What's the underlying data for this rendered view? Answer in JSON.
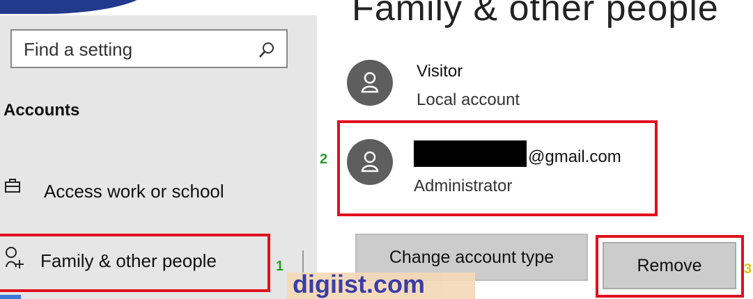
{
  "colors": {
    "highlight": "#e0101e",
    "step_number": "#2a9d2a",
    "avatar_bg": "#5e5e5e",
    "watermark_text": "#2a2ea0"
  },
  "page": {
    "title": "Family & other people"
  },
  "search": {
    "placeholder": "Find a setting"
  },
  "sidebar": {
    "section_title": "Accounts",
    "items": [
      {
        "label": "Access work or school",
        "icon": "briefcase-icon"
      },
      {
        "label": "Family & other people",
        "icon": "person-add-icon"
      }
    ]
  },
  "accounts": [
    {
      "name": "Visitor",
      "type": "Local account"
    },
    {
      "name": "@gmail.com",
      "type": "Administrator",
      "redacted": true
    }
  ],
  "buttons": {
    "change_type": "Change account type",
    "remove": "Remove"
  },
  "steps": [
    "1",
    "2",
    "3"
  ],
  "watermark": "digiist.com"
}
